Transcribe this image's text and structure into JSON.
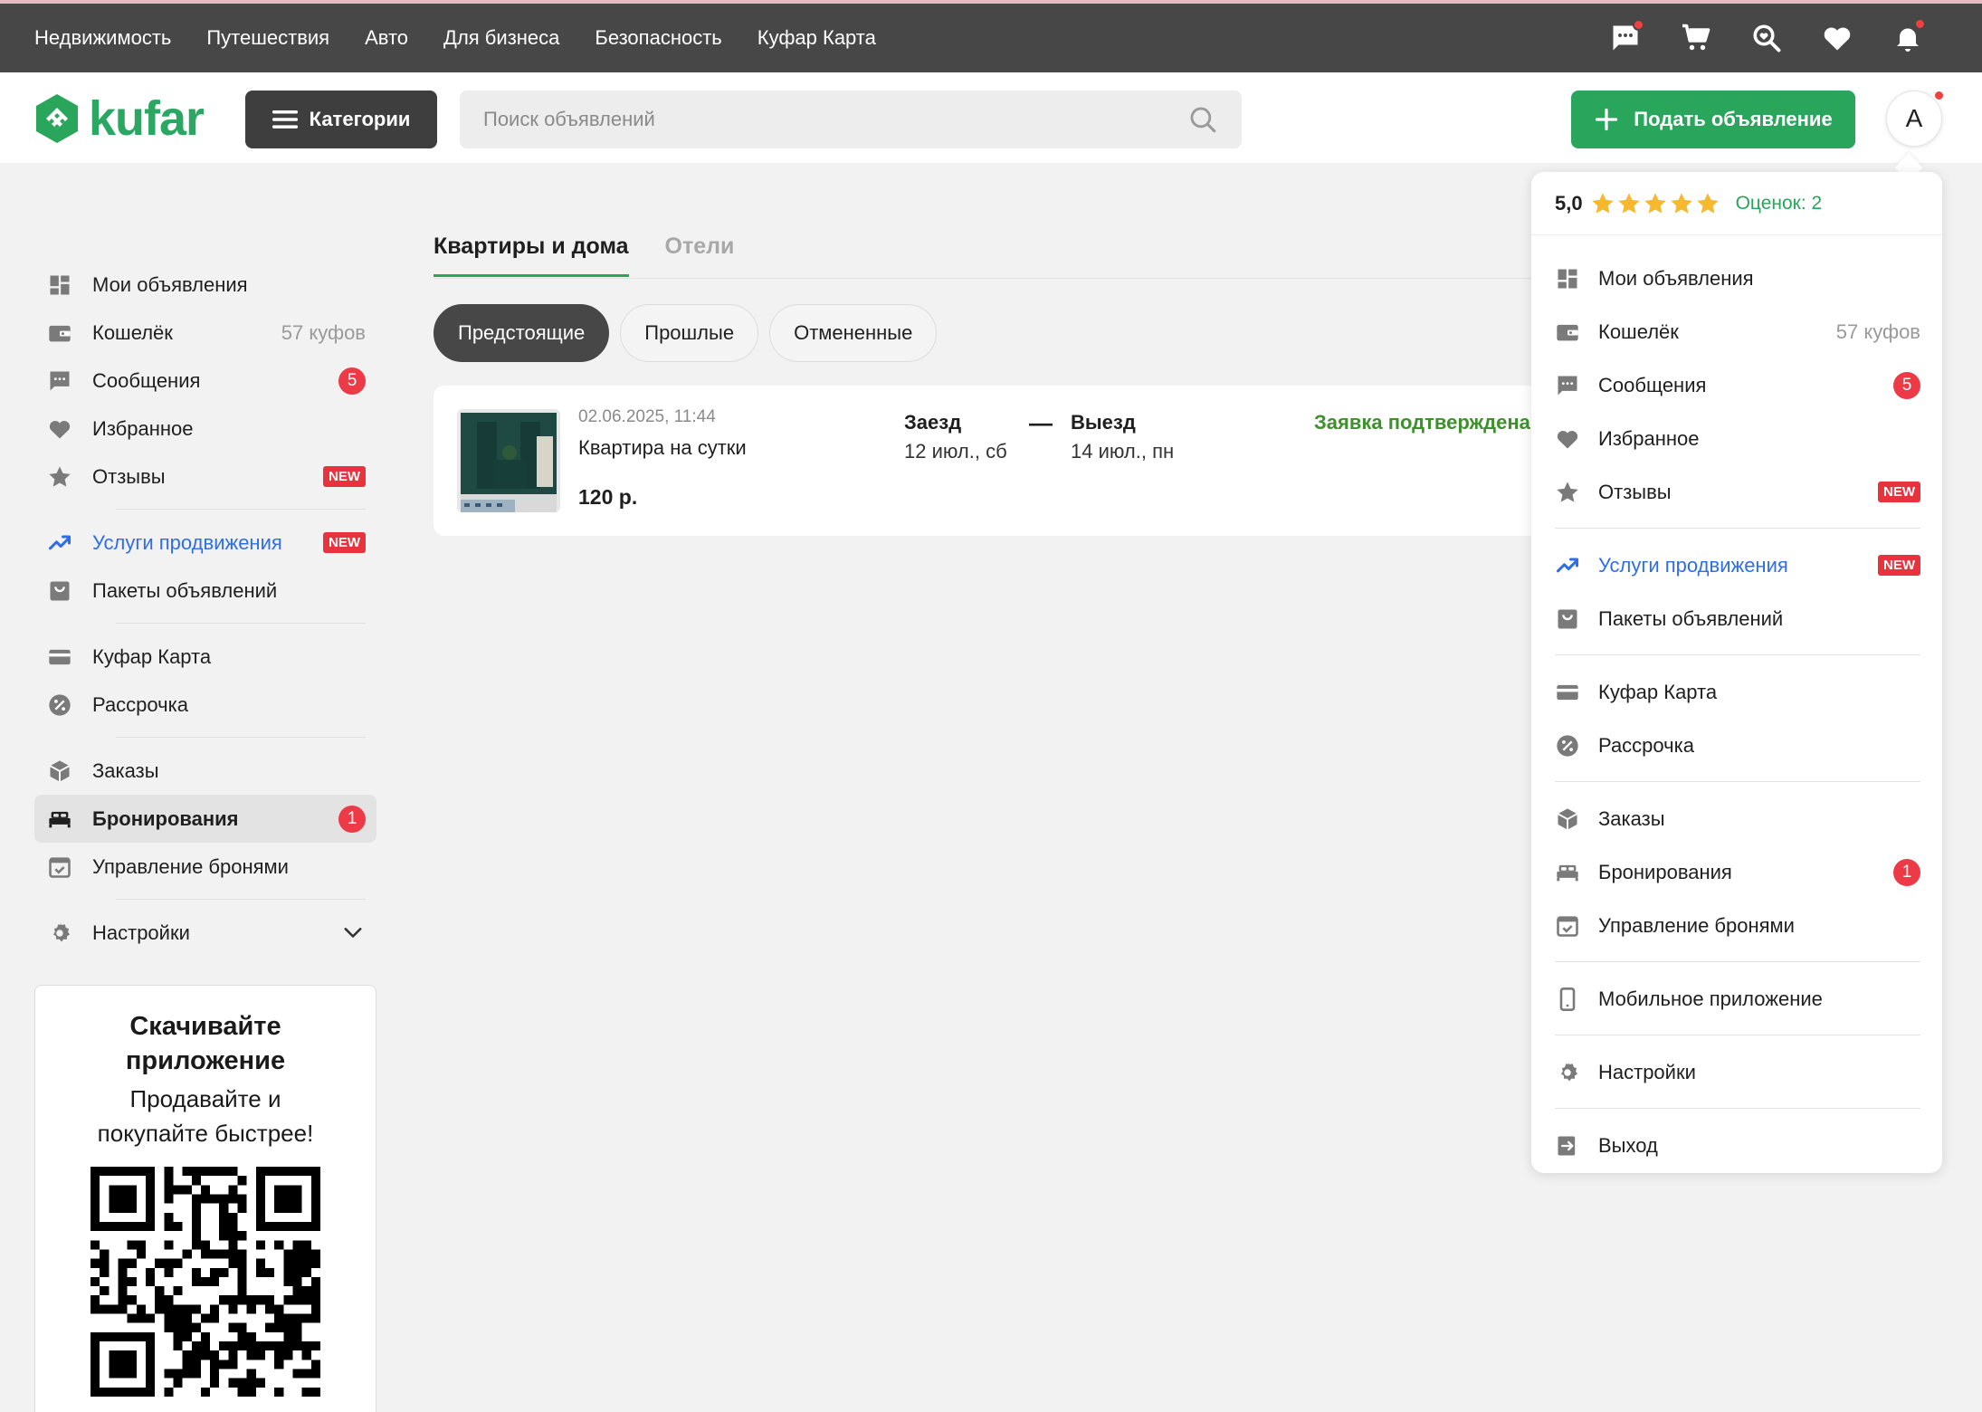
{
  "topnav": [
    "Недвижимость",
    "Путешествия",
    "Авто",
    "Для бизнеса",
    "Безопасность",
    "Куфар Карта"
  ],
  "header": {
    "logo": "kufar",
    "categories_label": "Категории",
    "search_placeholder": "Поиск объявлений",
    "post_label": "Подать объявление",
    "avatar_letter": "А"
  },
  "sidebar": {
    "my_ads": "Мои объявления",
    "wallet": "Кошелёк",
    "wallet_value": "57 куфов",
    "messages": "Сообщения",
    "messages_count": "5",
    "favorites": "Избранное",
    "reviews": "Отзывы",
    "new_badge": "NEW",
    "promo": "Услуги продвижения",
    "packages": "Пакеты объявлений",
    "card": "Куфар Карта",
    "installment": "Рассрочка",
    "orders": "Заказы",
    "bookings": "Бронирования",
    "bookings_count": "1",
    "manage_bookings": "Управление бронями",
    "settings": "Настройки"
  },
  "download": {
    "title": "Скачивайте приложение",
    "subtitle": "Продавайте и покупайте быстрее!"
  },
  "main": {
    "tabs": [
      "Квартиры и дома",
      "Отели"
    ],
    "filters": [
      "Предстоящие",
      "Прошлые",
      "Отмененные"
    ],
    "booking": {
      "date": "02.06.2025, 11:44",
      "title": "Квартира на сутки",
      "price": "120 р.",
      "checkin_label": "Заезд",
      "checkin_date": "12 июл., сб",
      "dash": "—",
      "checkout_label": "Выезд",
      "checkout_date": "14 июл., пн",
      "status": "Заявка подтверждена"
    }
  },
  "dropdown": {
    "score": "5,0",
    "stars": 5,
    "ratings_count": "Оценок: 2",
    "my_ads": "Мои объявления",
    "wallet": "Кошелёк",
    "wallet_value": "57 куфов",
    "messages": "Сообщения",
    "messages_count": "5",
    "favorites": "Избранное",
    "reviews": "Отзывы",
    "new_badge": "NEW",
    "promo": "Услуги продвижения",
    "packages": "Пакеты объявлений",
    "card": "Куфар Карта",
    "installment": "Рассрочка",
    "orders": "Заказы",
    "bookings": "Бронирования",
    "bookings_count": "1",
    "manage_bookings": "Управление бронями",
    "mobile_app": "Мобильное приложение",
    "settings": "Настройки",
    "logout": "Выход"
  },
  "colors": {
    "brand_green": "#2aa55c",
    "topbar": "#474747",
    "badge_red": "#ec3b47",
    "link_blue": "#2f6ee8",
    "status_green": "#3f8f2f",
    "star": "#f5b82e"
  }
}
